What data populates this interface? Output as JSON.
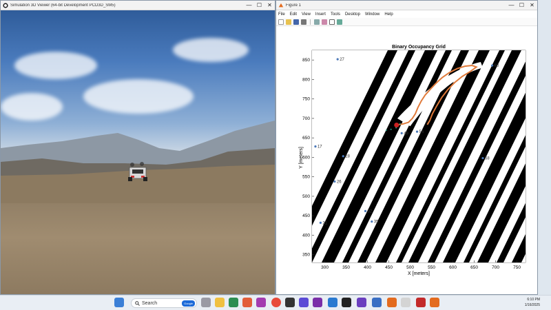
{
  "sim_window": {
    "title": "Simulation 3D Viewer (64-bit Development PCD3D_SM5)",
    "controls": {
      "minimize": "—",
      "maximize": "☐",
      "close": "✕"
    }
  },
  "figure_window": {
    "title": "Figure 1",
    "controls": {
      "minimize": "—",
      "maximize": "☐",
      "close": "✕"
    },
    "menu": [
      "File",
      "Edit",
      "View",
      "Insert",
      "Tools",
      "Desktop",
      "Window",
      "Help"
    ],
    "toolbar_icons": [
      "new-file-icon",
      "open-file-icon",
      "save-icon",
      "print-icon",
      "link-icon",
      "data-cursor-icon",
      "pointer-icon",
      "property-editor-icon"
    ]
  },
  "chart_data": {
    "type": "scatter",
    "title": "Binary Occupancy Grid",
    "xlabel": "X [meters]",
    "ylabel": "Y [meters]",
    "xlim": [
      270,
      770
    ],
    "ylim": [
      330,
      875
    ],
    "xticks": [
      300,
      350,
      400,
      450,
      500,
      550,
      600,
      650,
      700,
      750
    ],
    "yticks": [
      350,
      400,
      450,
      500,
      550,
      600,
      650,
      700,
      750,
      800,
      850
    ],
    "path": [
      [
        473,
        684
      ],
      [
        484,
        686
      ],
      [
        496,
        690
      ],
      [
        505,
        700
      ],
      [
        512,
        712
      ],
      [
        518,
        728
      ],
      [
        526,
        745
      ],
      [
        535,
        760
      ],
      [
        548,
        776
      ],
      [
        560,
        790
      ],
      [
        575,
        805
      ],
      [
        592,
        818
      ],
      [
        610,
        828
      ],
      [
        628,
        834
      ],
      [
        645,
        836
      ],
      [
        655,
        832
      ],
      [
        640,
        820
      ],
      [
        622,
        808
      ],
      [
        604,
        792
      ],
      [
        588,
        774
      ],
      [
        574,
        754
      ],
      [
        562,
        732
      ],
      [
        552,
        712
      ],
      [
        546,
        695
      ],
      [
        540,
        684
      ]
    ],
    "vehicle_position": [
      468,
      683
    ],
    "waypoints": [
      {
        "label": "27",
        "x": 330,
        "y": 852
      },
      {
        "label": "60",
        "x": 692,
        "y": 836
      },
      {
        "label": "49",
        "x": 480,
        "y": 662
      },
      {
        "label": "56",
        "x": 516,
        "y": 666
      },
      {
        "label": "17",
        "x": 278,
        "y": 628
      },
      {
        "label": "28",
        "x": 343,
        "y": 603
      },
      {
        "label": "26",
        "x": 323,
        "y": 538
      },
      {
        "label": "58",
        "x": 670,
        "y": 598
      },
      {
        "label": "32",
        "x": 395,
        "y": 462
      },
      {
        "label": "35",
        "x": 410,
        "y": 435
      },
      {
        "label": "21",
        "x": 290,
        "y": 432
      }
    ],
    "grid": false
  },
  "taskbar": {
    "search_placeholder": "Search",
    "search_chip": "Google",
    "time": "6:10 PM",
    "date": "1/16/2025"
  },
  "colors": {
    "path": "#e07a3a",
    "vehicle": "#cc2222",
    "waypoint": "#4a78b8",
    "approach": "#2aa58a",
    "occupied": "#000000",
    "free": "#ffffff"
  }
}
